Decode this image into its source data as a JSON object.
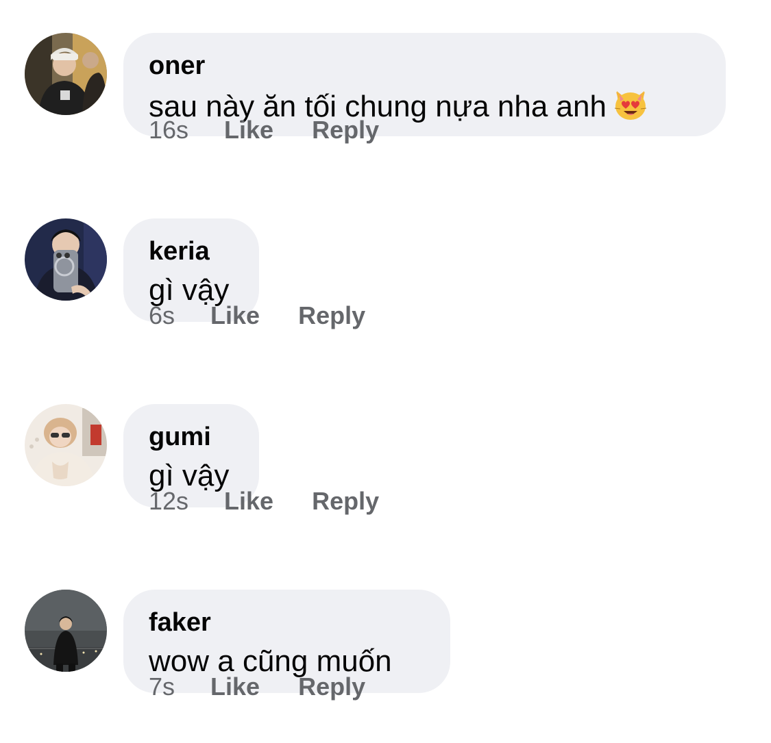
{
  "comments": [
    {
      "author": "oner",
      "text": "sau này ăn tối chung nựa nha anh",
      "emoji": "smiling-cat-heart-eyes-emoji",
      "time": "16s",
      "like_label": "Like",
      "reply_label": "Reply"
    },
    {
      "author": "keria",
      "text": "gì vậy",
      "time": "6s",
      "like_label": "Like",
      "reply_label": "Reply"
    },
    {
      "author": "gumi",
      "text": "gì vậy",
      "time": "12s",
      "like_label": "Like",
      "reply_label": "Reply"
    },
    {
      "author": "faker",
      "text": "wow a cũng muốn",
      "time": "7s",
      "like_label": "Like",
      "reply_label": "Reply"
    }
  ],
  "colors": {
    "bubble_bg": "#eff0f4",
    "text": "#050505",
    "meta": "#65676b"
  }
}
